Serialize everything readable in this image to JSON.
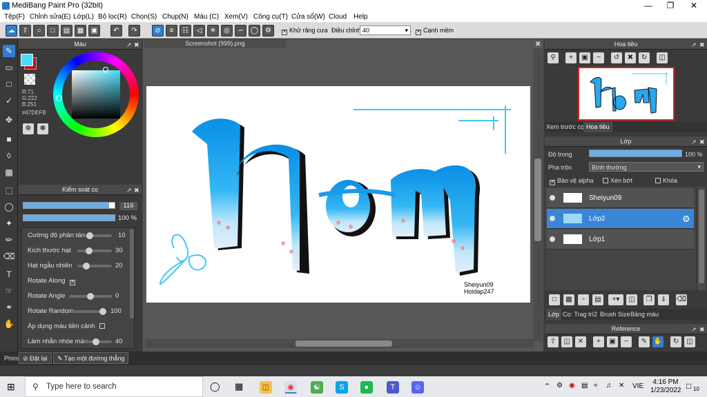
{
  "app": {
    "title": "MediBang Paint Pro (32bit)"
  },
  "menu": [
    "Tệp(F)",
    "Chỉnh sửa(E)",
    "Lớp(L)",
    "Bộ lọc(R)",
    "Chọn(S)",
    "Chụp(N)",
    "Màu (C)",
    "Xem(V)",
    "Công cụ(T)",
    "Cửa sổ(W)",
    "Cloud",
    "Help"
  ],
  "toolbar": {
    "antialias_label": "Khử răng cưa",
    "adjust_label": "Điều chỉnh",
    "adjust_value": "40",
    "sharp_label": "Cạnh mềm"
  },
  "color_panel": {
    "title": "Màu",
    "r": "R:71",
    "g": "G:222",
    "b": "B:251",
    "hex": "#47DEFB",
    "fg_color": "#47DEFB",
    "bg_color": "#C0101A"
  },
  "brush_panel": {
    "title": "Kiểm soát cọ",
    "size_value": "116",
    "opacity_value": "100 %",
    "rows": [
      {
        "label": "Cường độ phân tán",
        "value": "10",
        "level": 0.1
      },
      {
        "label": "Kích thước hạt",
        "value": "30",
        "level": 0.3
      },
      {
        "label": "Hạt ngẫu nhiên",
        "value": "20",
        "level": 0.2
      },
      {
        "label": "Rotate Along",
        "value": "",
        "level": null
      },
      {
        "label": "Rotate Angle",
        "value": "0",
        "level": 0.5
      },
      {
        "label": "Rotate Random",
        "value": "100",
        "level": 1.0
      },
      {
        "label": "Áp dụng màu tiền cảnh",
        "value": "",
        "level": null
      },
      {
        "label": "Làm nhẵn nhòe màu",
        "value": "40",
        "level": 0.4
      }
    ]
  },
  "document": {
    "tab": "Screenshot (999).png"
  },
  "canvas": {
    "signature_line1": "Sheiyun09",
    "signature_line2": "Hoidap247"
  },
  "navigator": {
    "title": "Hoa tiêu",
    "tab_preview": "Xem trước cọ",
    "tab_nav": "Hoa tiêu"
  },
  "layers": {
    "title": "Lớp",
    "opacity_label": "Độ trong",
    "opacity_value": "100 %",
    "opacity_level": 1.0,
    "blend_label": "Pha trộn",
    "blend_value": "Bình thường",
    "protect_alpha": "Bảo vệ alpha",
    "clipping": "Xén bớt",
    "lock": "Khóa",
    "items": [
      {
        "name": "Sheiyun09",
        "selected": false
      },
      {
        "name": "Lớp2",
        "selected": true
      },
      {
        "name": "Lớp1",
        "selected": false
      }
    ],
    "bottom_tabs": [
      "Lớp",
      "Cọ: Trag trí2",
      "Brush Size",
      "Bảng màu"
    ]
  },
  "reference": {
    "title": "Reference"
  },
  "statusbar": {
    "hotkey_label": "Phím",
    "reset_label": "Đặt lại",
    "straight_line_label": "Tạo một đường thẳng"
  },
  "taskbar": {
    "search_placeholder": "Type here to search",
    "lang": "VIE",
    "time": "4:16 PM",
    "date": "1/23/2022",
    "notif_count": "10"
  }
}
